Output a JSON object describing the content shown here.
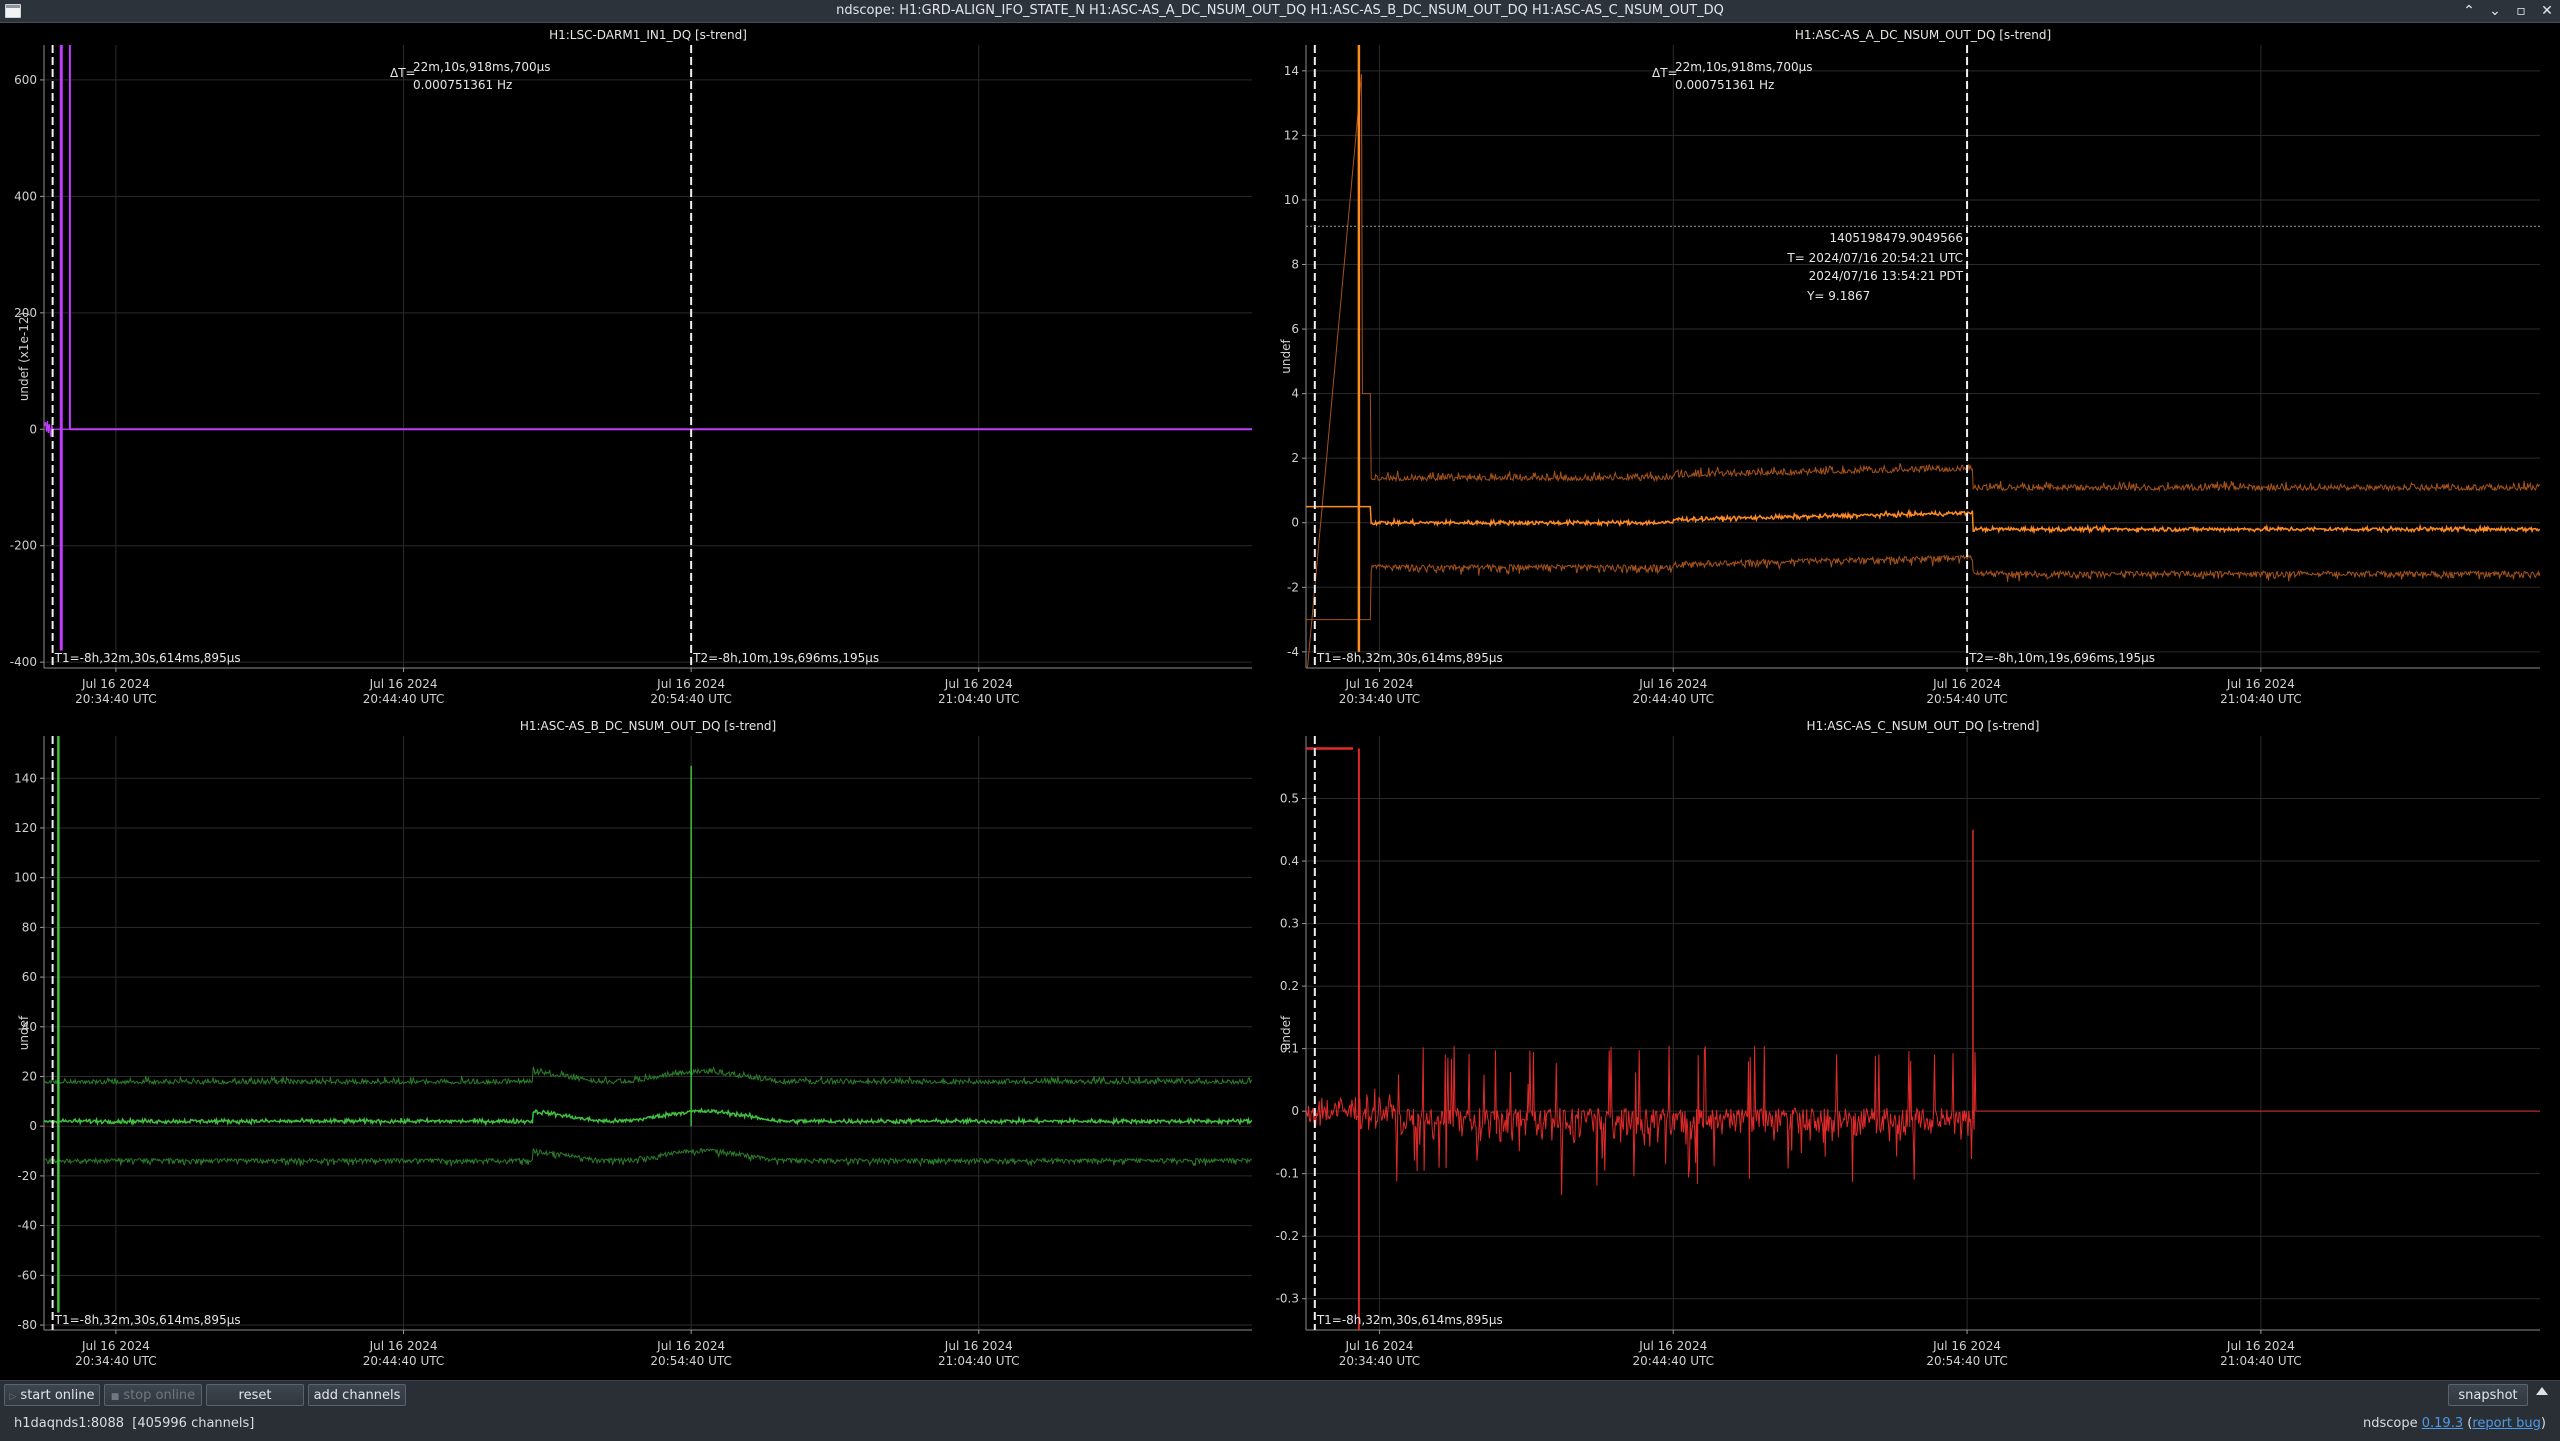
{
  "window": {
    "title": "ndscope: H1:GRD-ALIGN_IFO_STATE_N H1:ASC-AS_A_DC_NSUM_OUT_DQ H1:ASC-AS_B_DC_NSUM_OUT_DQ H1:ASC-AS_C_NSUM_OUT_DQ",
    "buttons": {
      "minimize": "⌃",
      "restore": "⌄",
      "maximize": "▫",
      "close": "✕"
    }
  },
  "controls": {
    "start_online": "start online",
    "stop_online": "stop online",
    "reset": "reset",
    "add_channels": "add channels",
    "snapshot": "snapshot"
  },
  "status": {
    "server": "h1daqnds1:8088",
    "channels": "[405996 channels]",
    "app_name": "ndscope",
    "version": "0.19.3",
    "report_bug": "report bug"
  },
  "x_axis_ticks": [
    {
      "date": "Jul 16 2024",
      "time": "20:34:40 UTC",
      "min": 0
    },
    {
      "date": "Jul 16 2024",
      "time": "20:44:40 UTC",
      "min": 10
    },
    {
      "date": "Jul 16 2024",
      "time": "20:54:40 UTC",
      "min": 20
    },
    {
      "date": "Jul 16 2024",
      "time": "21:04:40 UTC",
      "min": 30
    }
  ],
  "plots": [
    {
      "id": "darm",
      "title": "H1:LSC-DARM1_IN1_DQ [s-trend]",
      "ylabel": "undef (x1e-12)",
      "color": "#c23cff",
      "ylim": [
        -410,
        660
      ],
      "yticks": [
        -400,
        -200,
        0,
        200,
        400,
        600
      ],
      "xlim_min": [
        -2.5,
        39.5
      ],
      "delta_t": {
        "label": "ΔT=",
        "value": "22m,10s,918ms,700µs",
        "freq": "0.000751361 Hz"
      },
      "cursors": [
        {
          "label": "T1=-8h,32m,30s,614ms,895µs",
          "t_min": -2.2
        },
        {
          "label": "T2=-8h,10m,19s,696ms,195µs",
          "t_min": 20.0
        }
      ]
    },
    {
      "id": "as_a",
      "title": "H1:ASC-AS_A_DC_NSUM_OUT_DQ [s-trend]",
      "ylabel": "undef",
      "color": "#ff8a1f",
      "band_color": "#a5531a",
      "ylim": [
        -4.5,
        14.8
      ],
      "yticks": [
        -4,
        -2,
        0,
        2,
        4,
        6,
        8,
        10,
        12,
        14
      ],
      "xlim_min": [
        -2.5,
        39.5
      ],
      "delta_t": {
        "label": "ΔT=",
        "value": "22m,10s,918ms,700µs",
        "freq": "0.000751361 Hz"
      },
      "cursors": [
        {
          "label": "T1=-8h,32m,30s,614ms,895µs",
          "t_min": -2.2
        },
        {
          "label": "T2=-8h,10m,19s,696ms,195µs",
          "t_min": 20.0
        }
      ],
      "ycursor": {
        "y": 9.1867,
        "gps": "1405198479.9049566",
        "t_utc": "T= 2024/07/16 20:54:21 UTC",
        "t_pdt": "2024/07/16 13:54:21 PDT",
        "y_label": "Y= 9.1867"
      }
    },
    {
      "id": "as_b",
      "title": "H1:ASC-AS_B_DC_NSUM_OUT_DQ [s-trend]",
      "ylabel": "undef",
      "color": "#3fc23f",
      "band_color": "#2a7d2a",
      "ylim": [
        -82,
        157
      ],
      "yticks": [
        -80,
        -60,
        -40,
        -20,
        0,
        20,
        40,
        60,
        80,
        100,
        120,
        140
      ],
      "xlim_min": [
        -2.5,
        39.5
      ],
      "cursors": [
        {
          "label": "T1=-8h,32m,30s,614ms,895µs",
          "t_min": -2.2
        }
      ]
    },
    {
      "id": "as_c",
      "title": "H1:ASC-AS_C_NSUM_OUT_DQ [s-trend]",
      "ylabel": "undef",
      "color": "#e02a2a",
      "ylim": [
        -0.35,
        0.6
      ],
      "yticks": [
        -0.3,
        -0.2,
        -0.1,
        0,
        0.1,
        0.2,
        0.3,
        0.4,
        0.5
      ],
      "xlim_min": [
        -2.5,
        39.5
      ],
      "cursors": [
        {
          "label": "T1=-8h,32m,30s,614ms,895µs",
          "t_min": -2.2
        }
      ]
    }
  ]
}
